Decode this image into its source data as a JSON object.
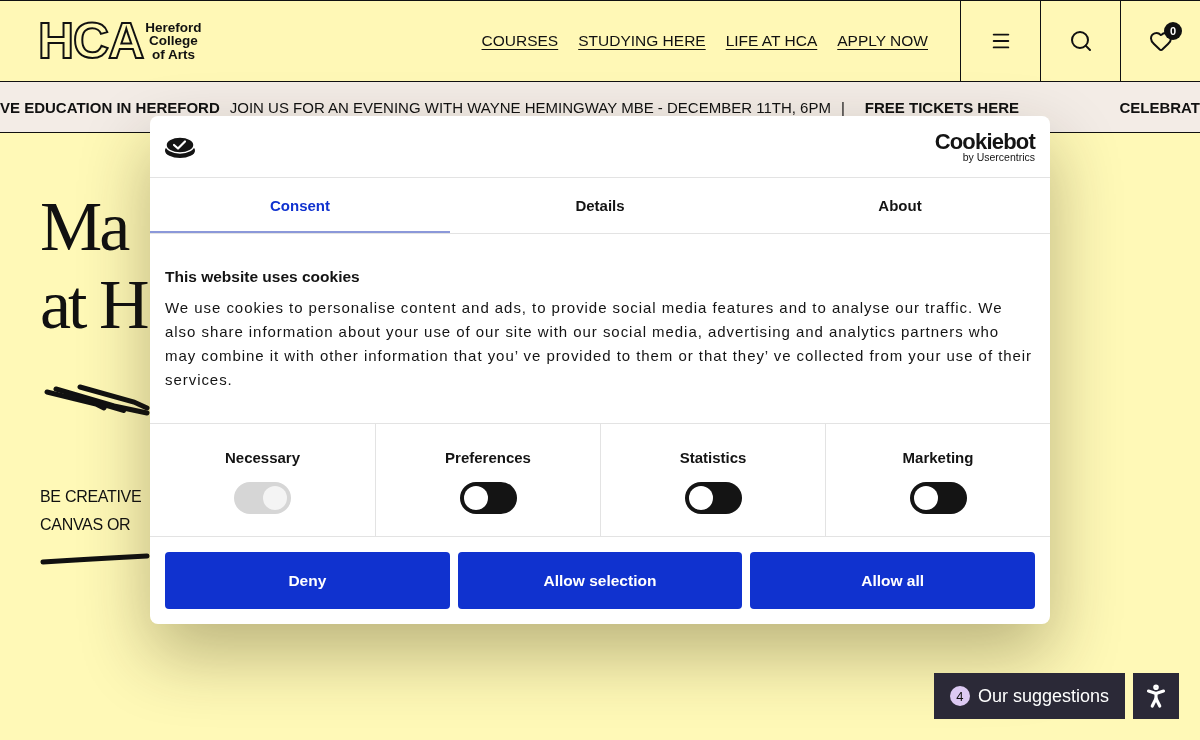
{
  "header": {
    "logo": {
      "mark": "HCA",
      "lines": [
        "Hereford",
        "College",
        "of Arts"
      ]
    },
    "nav": [
      "COURSES",
      "STUDYING HERE",
      "LIFE AT HCA",
      "APPLY NOW"
    ],
    "favourites_count": "0"
  },
  "ticker": [
    {
      "kind": "bold",
      "text": "VE EDUCATION IN HEREFORD"
    },
    {
      "kind": "plain",
      "text": "JOIN US FOR AN EVENING WITH WAYNE HEMINGWAY MBE - DECEMBER 11TH, 6PM"
    },
    {
      "kind": "plain",
      "text": "|"
    },
    {
      "kind": "link",
      "text": "FREE TICKETS HERE"
    },
    {
      "kind": "bold",
      "text": "CELEBRAT"
    }
  ],
  "hero": {
    "heading_lines": [
      "Ma",
      "at H"
    ],
    "intro_lines": [
      "BE CREATIVE",
      "CANVAS OR"
    ]
  },
  "cookie_dialog": {
    "brand": {
      "name": "Cookiebot",
      "byline": "by Usercentrics"
    },
    "tabs": [
      {
        "label": "Consent",
        "selected": true
      },
      {
        "label": "Details",
        "selected": false
      },
      {
        "label": "About",
        "selected": false
      }
    ],
    "title": "This website uses cookies",
    "body": "We use cookies to personalise content and ads, to provide social media features and to analyse our traffic. We also share information about your use of our site with our social media, advertising and analytics partners who may combine it with other information that you’ ve provided to them or that they’ ve collected from your use of their services.",
    "categories": [
      {
        "label": "Necessary",
        "checked": true,
        "disabled": true
      },
      {
        "label": "Preferences",
        "checked": false,
        "disabled": false
      },
      {
        "label": "Statistics",
        "checked": false,
        "disabled": false
      },
      {
        "label": "Marketing",
        "checked": false,
        "disabled": false
      }
    ],
    "buttons": [
      "Deny",
      "Allow selection",
      "Allow all"
    ]
  },
  "suggestions": {
    "count": "4",
    "label": "Our suggestions"
  }
}
